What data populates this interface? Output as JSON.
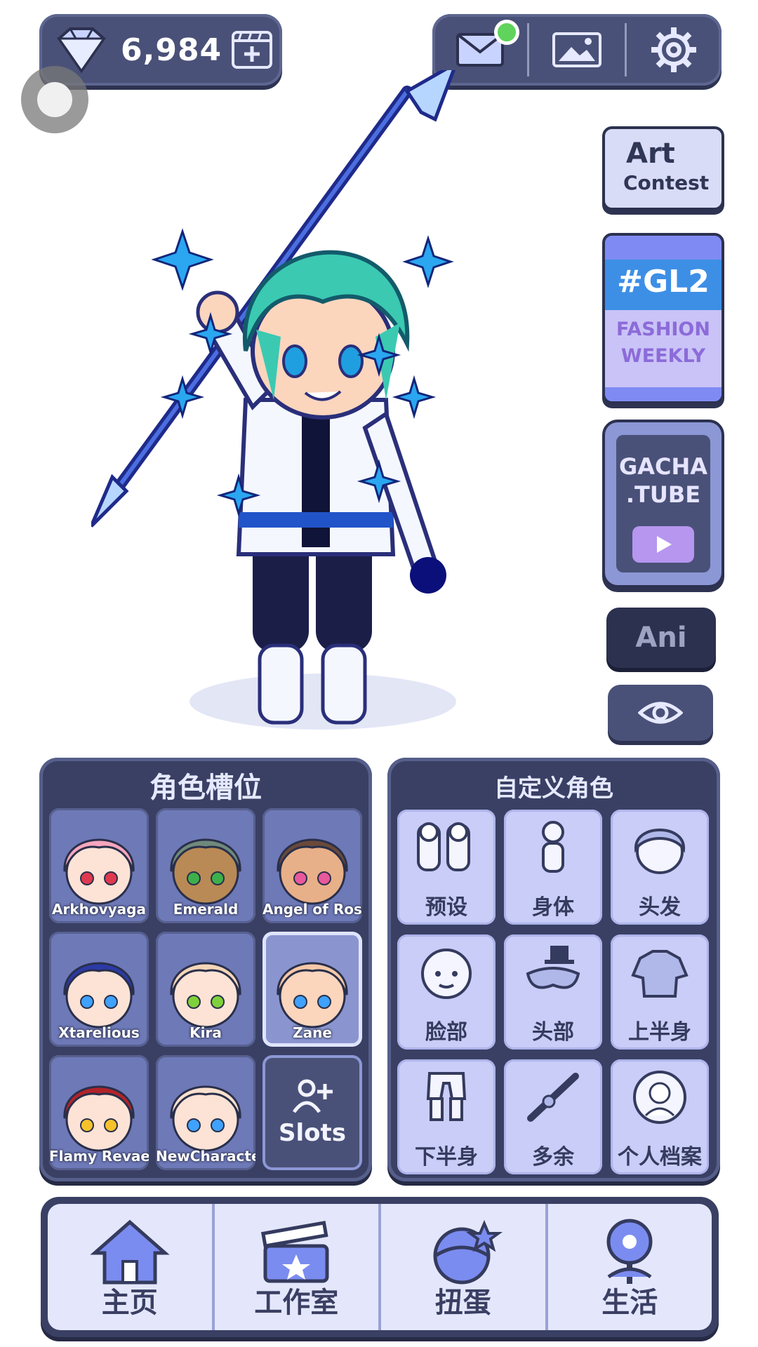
{
  "currency": {
    "amount": "6,984",
    "icon": "diamond-icon",
    "add_icon": "film-add-icon"
  },
  "top_bar": {
    "mail_icon": "mail-icon",
    "gallery_icon": "image-icon",
    "settings_icon": "gear-icon",
    "notification_color": "#5fd35b"
  },
  "side_buttons": {
    "art_contest": {
      "line1": "Art",
      "line2": "Contest"
    },
    "gl2": {
      "tag": "#GL2",
      "line1": "FASHION",
      "line2": "WEEKLY"
    },
    "gacha_tube": {
      "line1": "GACHA",
      "line2": ".TUBE"
    },
    "ani": "Ani",
    "visibility_icon": "eye-icon"
  },
  "slots_panel": {
    "title": "角色槽位",
    "slots": [
      {
        "name": "Arkhovyaga",
        "hair": "#f7a6bd",
        "eyes": "#e0394f",
        "skin": "#fde3d6"
      },
      {
        "name": "Emerald",
        "hair": "#6f8a7c",
        "eyes": "#3eb04b",
        "skin": "#b98a55"
      },
      {
        "name": "Angel of Roses",
        "hair": "#6a4a3a",
        "eyes": "#e8589c",
        "skin": "#e8b088"
      },
      {
        "name": "Xtarelious",
        "hair": "#2b3aa6",
        "eyes": "#3fa2ff",
        "skin": "#fde3d6"
      },
      {
        "name": "Kira",
        "hair": "#f4d6b8",
        "eyes": "#7fd13b",
        "skin": "#fde3d6"
      },
      {
        "name": "Zane",
        "hair": "#f6c8a8",
        "eyes": "#3fa2ff",
        "skin": "#fcd5bd"
      },
      {
        "name": "Flamy Revaes",
        "hair": "#b3232a",
        "eyes": "#f5c22b",
        "skin": "#fde3d6"
      },
      {
        "name": "NewCharacter",
        "hair": "#fbe1cf",
        "eyes": "#3fa2ff",
        "skin": "#fde3d6"
      }
    ],
    "add_slots_label": "Slots",
    "add_slots_icon": "add-user-icon"
  },
  "custom_panel": {
    "title": "自定义角色",
    "categories": [
      {
        "label": "预设",
        "icon": "preset-icon"
      },
      {
        "label": "身体",
        "icon": "body-icon"
      },
      {
        "label": "头发",
        "icon": "hair-icon"
      },
      {
        "label": "脸部",
        "icon": "face-icon"
      },
      {
        "label": "头部",
        "icon": "head-accessory-icon"
      },
      {
        "label": "上半身",
        "icon": "upper-body-icon"
      },
      {
        "label": "下半身",
        "icon": "lower-body-icon"
      },
      {
        "label": "多余",
        "icon": "extra-icon"
      },
      {
        "label": "个人档案",
        "icon": "profile-icon"
      }
    ]
  },
  "bottom_nav": [
    {
      "label": "主页",
      "icon": "home-icon"
    },
    {
      "label": "工作室",
      "icon": "studio-icon"
    },
    {
      "label": "扭蛋",
      "icon": "gacha-icon"
    },
    {
      "label": "生活",
      "icon": "life-icon"
    }
  ],
  "colors": {
    "panel": "#3a4064",
    "accent": "#8c97d6",
    "hair": "#3bc9b2",
    "sparkle": "#2aa7f0"
  }
}
